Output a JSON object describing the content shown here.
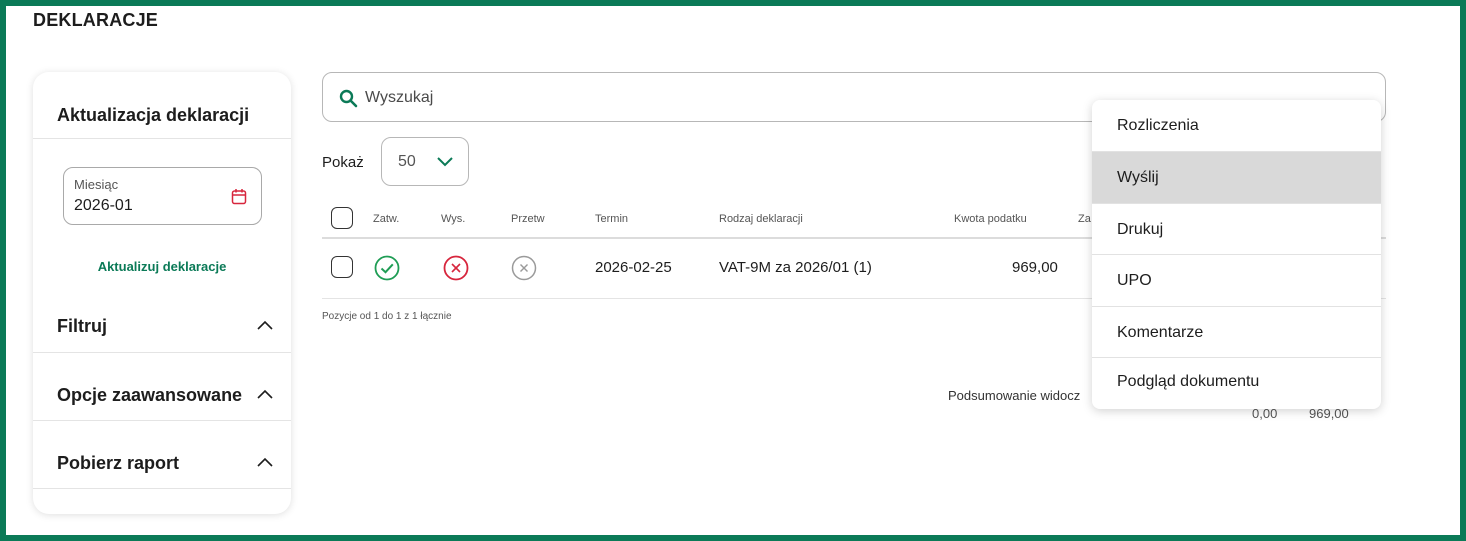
{
  "page": {
    "title": "DEKLARACJE"
  },
  "colors": {
    "brand_green": "#0b7a57",
    "danger_red": "#d7263d",
    "neutral_grey": "#9a9a9a"
  },
  "sidebar": {
    "heading": "Aktualizacja deklaracji",
    "month": {
      "label": "Miesiąc",
      "value": "2026-01",
      "icon": "calendar-icon"
    },
    "update_link": "Aktualizuj deklaracje",
    "sections": [
      {
        "label": "Filtruj",
        "icon": "chevron-up-icon"
      },
      {
        "label": "Opcje zaawansowane",
        "icon": "chevron-up-icon"
      },
      {
        "label": "Pobierz raport",
        "icon": "chevron-up-icon"
      }
    ]
  },
  "search": {
    "placeholder": "Wyszukaj",
    "value": "",
    "icon": "search-icon"
  },
  "pagination": {
    "show_label": "Pokaż",
    "page_size": "50",
    "info": "Pozycje od 1 do 1 z 1 łącznie"
  },
  "table": {
    "columns": {
      "approved": "Zatw.",
      "sent": "Wys.",
      "processed": "Przetw",
      "deadline": "Termin",
      "type": "Rodzaj deklaracji",
      "tax_amount": "Kwota podatku",
      "truncated": "Za"
    },
    "rows": [
      {
        "approved": "check-circle-icon",
        "sent": "x-circle-icon",
        "processed": "x-circle-icon",
        "deadline": "2026-02-25",
        "type": "VAT-9M za 2026/01 (1)",
        "tax_amount": "969,00"
      }
    ]
  },
  "summary": {
    "label": "Podsumowanie widocz",
    "values": [
      "0,00",
      "969,00"
    ]
  },
  "context_menu": {
    "items": [
      "Rozliczenia",
      "Wyślij",
      "Drukuj",
      "UPO",
      "Komentarze",
      "Podgląd dokumentu"
    ],
    "highlighted": "Wyślij"
  }
}
